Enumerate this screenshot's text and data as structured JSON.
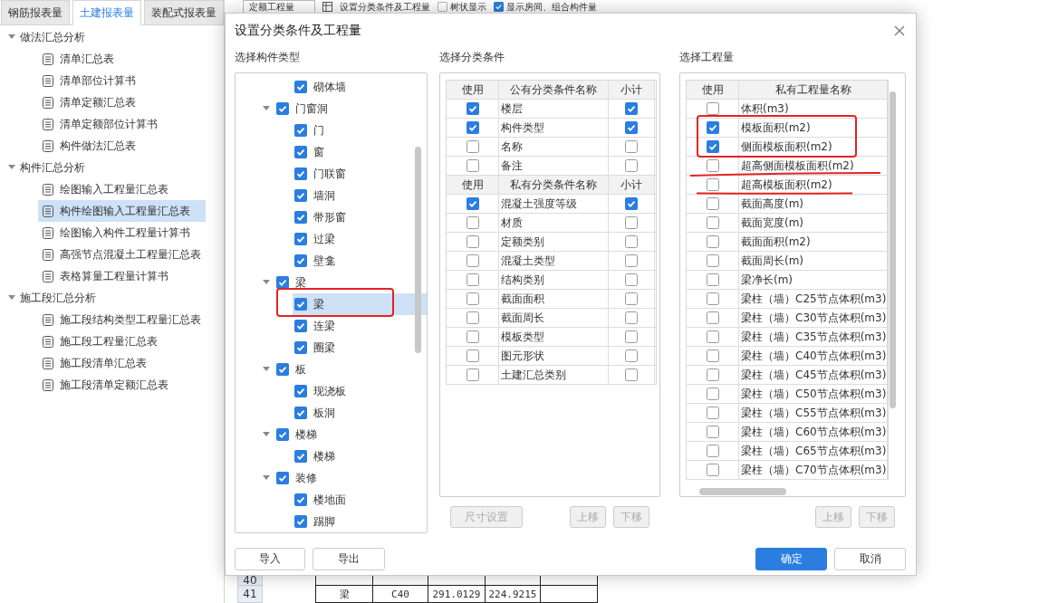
{
  "tabs": [
    {
      "label": "钢筋报表量",
      "selected": false
    },
    {
      "label": "土建报表量",
      "selected": true
    },
    {
      "label": "装配式报表量",
      "selected": false
    }
  ],
  "sidebar": {
    "groups": [
      {
        "label": "做法汇总分析",
        "expanded": true,
        "items": [
          {
            "label": "清单汇总表",
            "selected": false
          },
          {
            "label": "清单部位计算书",
            "selected": false
          },
          {
            "label": "清单定额汇总表",
            "selected": false
          },
          {
            "label": "清单定额部位计算书",
            "selected": false
          },
          {
            "label": "构件做法汇总表",
            "selected": false
          }
        ]
      },
      {
        "label": "构件汇总分析",
        "expanded": true,
        "items": [
          {
            "label": "绘图输入工程量汇总表",
            "selected": false
          },
          {
            "label": "构件绘图输入工程量汇总表",
            "selected": true
          },
          {
            "label": "绘图输入构件工程量计算书",
            "selected": false
          },
          {
            "label": "高强节点混凝土工程量汇总表",
            "selected": false
          },
          {
            "label": "表格算量工程量计算书",
            "selected": false
          }
        ]
      },
      {
        "label": "施工段汇总分析",
        "expanded": true,
        "items": [
          {
            "label": "施工段结构类型工程量汇总表",
            "selected": false
          },
          {
            "label": "施工段工程量汇总表",
            "selected": false
          },
          {
            "label": "施工段清单汇总表",
            "selected": false
          },
          {
            "label": "施工段清单定额汇总表",
            "selected": false
          }
        ]
      }
    ]
  },
  "toolbar": {
    "dropdown": "定额工程量",
    "settings_label": "设置分类条件及工程量",
    "options": [
      {
        "label": "树状显示",
        "checked": false
      },
      {
        "label": "显示房间、组合构件量",
        "checked": true
      }
    ]
  },
  "sheet": {
    "rows": [
      {
        "number": "40",
        "cells": []
      },
      {
        "number": "41",
        "cells": [
          "梁",
          "C40",
          "291.0129",
          "224.9215"
        ]
      }
    ]
  },
  "dialog": {
    "title": "设置分类条件及工程量",
    "component_panel": {
      "heading": "选择构件类型",
      "tree": [
        {
          "label": "砌体墙",
          "checked": true,
          "selected": false
        },
        {
          "label": "门窗洞",
          "checked": true,
          "expanded": true,
          "children": [
            {
              "label": "门",
              "checked": true,
              "selected": false
            },
            {
              "label": "窗",
              "checked": true,
              "selected": false
            },
            {
              "label": "门联窗",
              "checked": true,
              "selected": false
            },
            {
              "label": "墙洞",
              "checked": true,
              "selected": false
            },
            {
              "label": "带形窗",
              "checked": true,
              "selected": false
            },
            {
              "label": "过梁",
              "checked": true,
              "selected": false
            },
            {
              "label": "壁龛",
              "checked": true,
              "selected": false
            }
          ]
        },
        {
          "label": "梁",
          "checked": true,
          "expanded": true,
          "children": [
            {
              "label": "梁",
              "checked": true,
              "selected": true
            },
            {
              "label": "连梁",
              "checked": true,
              "selected": false
            },
            {
              "label": "圈梁",
              "checked": true,
              "selected": false
            }
          ]
        },
        {
          "label": "板",
          "checked": true,
          "expanded": true,
          "children": [
            {
              "label": "现浇板",
              "checked": true,
              "selected": false
            },
            {
              "label": "板洞",
              "checked": true,
              "selected": false
            }
          ]
        },
        {
          "label": "楼梯",
          "checked": true,
          "expanded": true,
          "children": [
            {
              "label": "楼梯",
              "checked": true,
              "selected": false
            }
          ]
        },
        {
          "label": "装修",
          "checked": true,
          "expanded": true,
          "children": [
            {
              "label": "楼地面",
              "checked": true,
              "selected": false
            },
            {
              "label": "踢脚",
              "checked": true,
              "selected": false
            }
          ]
        }
      ]
    },
    "condition_panel": {
      "heading": "选择分类条件",
      "sections": [
        {
          "columns": [
            "使用",
            "公有分类条件名称",
            "小计"
          ],
          "rows": [
            {
              "name": "楼层",
              "use": true,
              "subtotal": true
            },
            {
              "name": "构件类型",
              "use": true,
              "subtotal": true
            },
            {
              "name": "名称",
              "use": false,
              "subtotal": false
            },
            {
              "name": "备注",
              "use": false,
              "subtotal": false
            }
          ]
        },
        {
          "columns": [
            "使用",
            "私有分类条件名称",
            "小计"
          ],
          "rows": [
            {
              "name": "混凝土强度等级",
              "use": true,
              "subtotal": true
            },
            {
              "name": "材质",
              "use": false,
              "subtotal": false
            },
            {
              "name": "定额类别",
              "use": false,
              "subtotal": false
            },
            {
              "name": "混凝土类型",
              "use": false,
              "subtotal": false
            },
            {
              "name": "结构类别",
              "use": false,
              "subtotal": false
            },
            {
              "name": "截面面积",
              "use": false,
              "subtotal": false
            },
            {
              "name": "截面周长",
              "use": false,
              "subtotal": false
            },
            {
              "name": "模板类型",
              "use": false,
              "subtotal": false
            },
            {
              "name": "图元形状",
              "use": false,
              "subtotal": false
            },
            {
              "name": "土建汇总类别",
              "use": false,
              "subtotal": false
            }
          ]
        }
      ],
      "buttons": [
        {
          "label": "尺寸设置",
          "disabled": true
        },
        {
          "label": "上移",
          "disabled": true
        },
        {
          "label": "下移",
          "disabled": true
        }
      ]
    },
    "quantity_panel": {
      "heading": "选择工程量",
      "columns": [
        "使用",
        "私有工程量名称"
      ],
      "rows": [
        {
          "name": "体积(m3)",
          "use": false
        },
        {
          "name": "模板面积(m2)",
          "use": true
        },
        {
          "name": "侧面模板面积(m2)",
          "use": true
        },
        {
          "name": "超高侧面模板面积(m2)",
          "use": false
        },
        {
          "name": "超高模板面积(m2)",
          "use": false
        },
        {
          "name": "截面高度(m)",
          "use": false
        },
        {
          "name": "截面宽度(m)",
          "use": false
        },
        {
          "name": "截面面积(m2)",
          "use": false
        },
        {
          "name": "截面周长(m)",
          "use": false
        },
        {
          "name": "梁净长(m)",
          "use": false
        },
        {
          "name": "梁柱（墙）C25节点体积(m3)",
          "use": false
        },
        {
          "name": "梁柱（墙）C30节点体积(m3)",
          "use": false
        },
        {
          "name": "梁柱（墙）C35节点体积(m3)",
          "use": false
        },
        {
          "name": "梁柱（墙）C40节点体积(m3)",
          "use": false
        },
        {
          "name": "梁柱（墙）C45节点体积(m3)",
          "use": false
        },
        {
          "name": "梁柱（墙）C50节点体积(m3)",
          "use": false
        },
        {
          "name": "梁柱（墙）C55节点体积(m3)",
          "use": false
        },
        {
          "name": "梁柱（墙）C60节点体积(m3)",
          "use": false
        },
        {
          "name": "梁柱（墙）C65节点体积(m3)",
          "use": false
        },
        {
          "name": "梁柱（墙）C70节点体积(m3)",
          "use": false
        }
      ],
      "buttons": [
        {
          "label": "上移",
          "disabled": true
        },
        {
          "label": "下移",
          "disabled": true
        }
      ]
    },
    "footer": {
      "left_buttons": [
        {
          "label": "导入"
        },
        {
          "label": "导出"
        }
      ],
      "right_buttons": [
        {
          "label": "确定",
          "primary": true
        },
        {
          "label": "取消",
          "primary": false
        }
      ]
    }
  }
}
